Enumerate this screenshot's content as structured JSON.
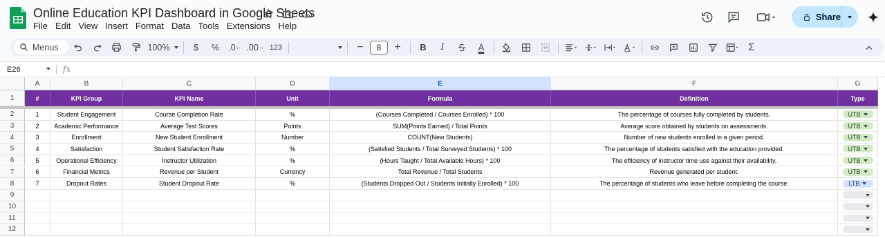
{
  "app": {
    "doc_title": "Online Education KPI Dashboard in Google Sheets",
    "menu": [
      "File",
      "Edit",
      "View",
      "Insert",
      "Format",
      "Data",
      "Tools",
      "Extensions",
      "Help"
    ],
    "share_label": "Share",
    "brand_color": "#0f9d58",
    "share_bg": "#c2e7ff"
  },
  "toolbar": {
    "search_label": "Menus",
    "zoom": "100%",
    "currency": "$",
    "percent": "%",
    "dec_decrease": ".0",
    "dec_increase": ".00",
    "number_format": "123",
    "font_size": "8",
    "minus": "−",
    "plus": "+",
    "bold": "B",
    "italic": "I",
    "text_color_letter": "A",
    "sigma": "Σ"
  },
  "formula_bar": {
    "cell_ref": "E26",
    "fx_label": "fx"
  },
  "sheet": {
    "columns": [
      "A",
      "B",
      "C",
      "D",
      "E",
      "F",
      "G"
    ],
    "selected_column": "E",
    "header_color": "#7030a0",
    "headers": [
      "#",
      "KPI Group",
      "KPI Name",
      "Unit",
      "Formula",
      "Definition",
      "Type"
    ],
    "row_numbers": [
      "1",
      "2",
      "3",
      "4",
      "5",
      "6",
      "7",
      "8",
      "9",
      "10",
      "11",
      "12"
    ],
    "rows": [
      {
        "num": "1",
        "group": "Student Engagement",
        "name": "Course Completion Rate",
        "unit": "%",
        "formula": "(Courses Completed / Courses Enrolled) * 100",
        "definition": "The percentage of courses fully completed by students.",
        "type": "UTB"
      },
      {
        "num": "2",
        "group": "Academic Performance",
        "name": "Average Test Scores",
        "unit": "Points",
        "formula": "SUM(Points Earned) / Total Points",
        "definition": "Average score obtained by students on assessments.",
        "type": "UTB"
      },
      {
        "num": "3",
        "group": "Enrollment",
        "name": "New Student Enrollment",
        "unit": "Number",
        "formula": "COUNT(New Students)",
        "definition": "Number of new students enrolled in a given period.",
        "type": "UTB"
      },
      {
        "num": "4",
        "group": "Satisfaction",
        "name": "Student Satisfaction Rate",
        "unit": "%",
        "formula": "(Satisfied Students / Total Surveyed Students) * 100",
        "definition": "The percentage of students satisfied with the education provided.",
        "type": "UTB"
      },
      {
        "num": "5",
        "group": "Operational Efficiency",
        "name": "Instructor Utilization",
        "unit": "%",
        "formula": "(Hours Taught / Total Available Hours) * 100",
        "definition": "The efficiency of instructor time use against their availability.",
        "type": "UTB"
      },
      {
        "num": "6",
        "group": "Financial Metrics",
        "name": "Revenue per Student",
        "unit": "Currency",
        "formula": "Total Revenue / Total Students",
        "definition": "Revenue generated per student.",
        "type": "UTB"
      },
      {
        "num": "7",
        "group": "Dropout Rates",
        "name": "Student Dropout Rate",
        "unit": "%",
        "formula": "(Students Dropped Out / Students Initially Enrolled) * 100",
        "definition": "The percentage of students who leave before completing the course.",
        "type": "LTB"
      }
    ]
  }
}
